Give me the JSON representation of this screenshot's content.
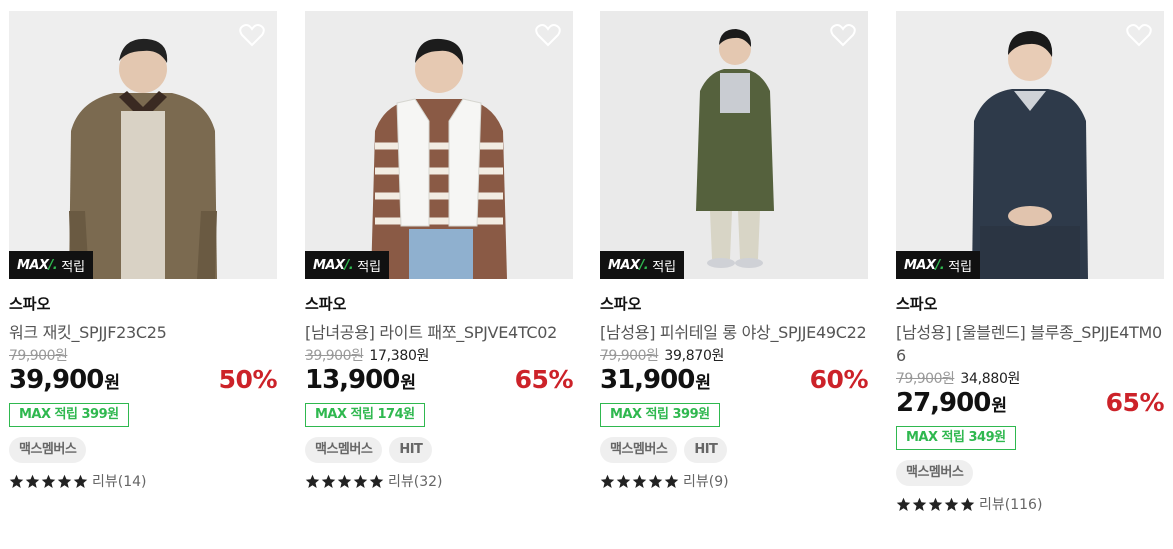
{
  "products": [
    {
      "max_tag": "적립",
      "max_logo": "MAX",
      "brand": "스파오",
      "name": "워크 재킷_SPJJF23C25",
      "original_price": "79,900원",
      "coupon_price": "",
      "sale_price": "39,900",
      "won": "원",
      "discount_rate": "50%",
      "points": "MAX 적립 399원",
      "chips": [
        "맥스멤버스"
      ],
      "review": "리뷰(14)",
      "rating_stars": 5
    },
    {
      "max_tag": "적립",
      "max_logo": "MAX",
      "brand": "스파오",
      "name": "[남녀공용] 라이트 패쪼_SPJVE4TC02",
      "original_price": "39,900원",
      "coupon_price": "17,380원",
      "sale_price": "13,900",
      "won": "원",
      "discount_rate": "65%",
      "points": "MAX 적립 174원",
      "chips": [
        "맥스멤버스",
        "HIT"
      ],
      "review": "리뷰(32)",
      "rating_stars": 5
    },
    {
      "max_tag": "적립",
      "max_logo": "MAX",
      "brand": "스파오",
      "name": "[남성용] 피쉬테일 롱 야상_SPJJE49C22",
      "original_price": "79,900원",
      "coupon_price": "39,870원",
      "sale_price": "31,900",
      "won": "원",
      "discount_rate": "60%",
      "points": "MAX 적립 399원",
      "chips": [
        "맥스멤버스",
        "HIT"
      ],
      "review": "리뷰(9)",
      "rating_stars": 5
    },
    {
      "max_tag": "적립",
      "max_logo": "MAX",
      "brand": "스파오",
      "name": "[남성용] [울블렌드] 블루종_SPJJE4TM06",
      "original_price": "79,900원",
      "coupon_price": "34,880원",
      "sale_price": "27,900",
      "won": "원",
      "discount_rate": "65%",
      "points": "MAX 적립 349원",
      "chips": [
        "맥스멤버스"
      ],
      "review": "리뷰(116)",
      "rating_stars": 5
    }
  ],
  "colors": {
    "discount": "#cc2229",
    "points_green": "#2fb84f",
    "chip_bg": "#efefef"
  },
  "icons": {
    "wishlist": "heart-outline-icon",
    "rating": "star-icon"
  }
}
